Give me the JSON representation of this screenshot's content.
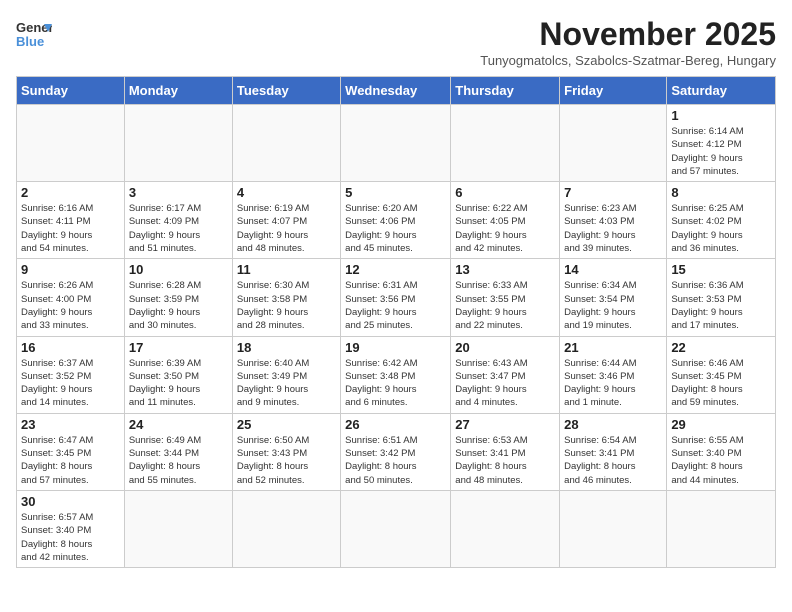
{
  "logo": {
    "text_general": "General",
    "text_blue": "Blue"
  },
  "title": "November 2025",
  "subtitle": "Tunyogmatolcs, Szabolcs-Szatmar-Bereg, Hungary",
  "weekdays": [
    "Sunday",
    "Monday",
    "Tuesday",
    "Wednesday",
    "Thursday",
    "Friday",
    "Saturday"
  ],
  "days": {
    "d1": {
      "n": "1",
      "info": "Sunrise: 6:14 AM\nSunset: 4:12 PM\nDaylight: 9 hours\nand 57 minutes."
    },
    "d2": {
      "n": "2",
      "info": "Sunrise: 6:16 AM\nSunset: 4:11 PM\nDaylight: 9 hours\nand 54 minutes."
    },
    "d3": {
      "n": "3",
      "info": "Sunrise: 6:17 AM\nSunset: 4:09 PM\nDaylight: 9 hours\nand 51 minutes."
    },
    "d4": {
      "n": "4",
      "info": "Sunrise: 6:19 AM\nSunset: 4:07 PM\nDaylight: 9 hours\nand 48 minutes."
    },
    "d5": {
      "n": "5",
      "info": "Sunrise: 6:20 AM\nSunset: 4:06 PM\nDaylight: 9 hours\nand 45 minutes."
    },
    "d6": {
      "n": "6",
      "info": "Sunrise: 6:22 AM\nSunset: 4:05 PM\nDaylight: 9 hours\nand 42 minutes."
    },
    "d7": {
      "n": "7",
      "info": "Sunrise: 6:23 AM\nSunset: 4:03 PM\nDaylight: 9 hours\nand 39 minutes."
    },
    "d8": {
      "n": "8",
      "info": "Sunrise: 6:25 AM\nSunset: 4:02 PM\nDaylight: 9 hours\nand 36 minutes."
    },
    "d9": {
      "n": "9",
      "info": "Sunrise: 6:26 AM\nSunset: 4:00 PM\nDaylight: 9 hours\nand 33 minutes."
    },
    "d10": {
      "n": "10",
      "info": "Sunrise: 6:28 AM\nSunset: 3:59 PM\nDaylight: 9 hours\nand 30 minutes."
    },
    "d11": {
      "n": "11",
      "info": "Sunrise: 6:30 AM\nSunset: 3:58 PM\nDaylight: 9 hours\nand 28 minutes."
    },
    "d12": {
      "n": "12",
      "info": "Sunrise: 6:31 AM\nSunset: 3:56 PM\nDaylight: 9 hours\nand 25 minutes."
    },
    "d13": {
      "n": "13",
      "info": "Sunrise: 6:33 AM\nSunset: 3:55 PM\nDaylight: 9 hours\nand 22 minutes."
    },
    "d14": {
      "n": "14",
      "info": "Sunrise: 6:34 AM\nSunset: 3:54 PM\nDaylight: 9 hours\nand 19 minutes."
    },
    "d15": {
      "n": "15",
      "info": "Sunrise: 6:36 AM\nSunset: 3:53 PM\nDaylight: 9 hours\nand 17 minutes."
    },
    "d16": {
      "n": "16",
      "info": "Sunrise: 6:37 AM\nSunset: 3:52 PM\nDaylight: 9 hours\nand 14 minutes."
    },
    "d17": {
      "n": "17",
      "info": "Sunrise: 6:39 AM\nSunset: 3:50 PM\nDaylight: 9 hours\nand 11 minutes."
    },
    "d18": {
      "n": "18",
      "info": "Sunrise: 6:40 AM\nSunset: 3:49 PM\nDaylight: 9 hours\nand 9 minutes."
    },
    "d19": {
      "n": "19",
      "info": "Sunrise: 6:42 AM\nSunset: 3:48 PM\nDaylight: 9 hours\nand 6 minutes."
    },
    "d20": {
      "n": "20",
      "info": "Sunrise: 6:43 AM\nSunset: 3:47 PM\nDaylight: 9 hours\nand 4 minutes."
    },
    "d21": {
      "n": "21",
      "info": "Sunrise: 6:44 AM\nSunset: 3:46 PM\nDaylight: 9 hours\nand 1 minute."
    },
    "d22": {
      "n": "22",
      "info": "Sunrise: 6:46 AM\nSunset: 3:45 PM\nDaylight: 8 hours\nand 59 minutes."
    },
    "d23": {
      "n": "23",
      "info": "Sunrise: 6:47 AM\nSunset: 3:45 PM\nDaylight: 8 hours\nand 57 minutes."
    },
    "d24": {
      "n": "24",
      "info": "Sunrise: 6:49 AM\nSunset: 3:44 PM\nDaylight: 8 hours\nand 55 minutes."
    },
    "d25": {
      "n": "25",
      "info": "Sunrise: 6:50 AM\nSunset: 3:43 PM\nDaylight: 8 hours\nand 52 minutes."
    },
    "d26": {
      "n": "26",
      "info": "Sunrise: 6:51 AM\nSunset: 3:42 PM\nDaylight: 8 hours\nand 50 minutes."
    },
    "d27": {
      "n": "27",
      "info": "Sunrise: 6:53 AM\nSunset: 3:41 PM\nDaylight: 8 hours\nand 48 minutes."
    },
    "d28": {
      "n": "28",
      "info": "Sunrise: 6:54 AM\nSunset: 3:41 PM\nDaylight: 8 hours\nand 46 minutes."
    },
    "d29": {
      "n": "29",
      "info": "Sunrise: 6:55 AM\nSunset: 3:40 PM\nDaylight: 8 hours\nand 44 minutes."
    },
    "d30": {
      "n": "30",
      "info": "Sunrise: 6:57 AM\nSunset: 3:40 PM\nDaylight: 8 hours\nand 42 minutes."
    }
  }
}
